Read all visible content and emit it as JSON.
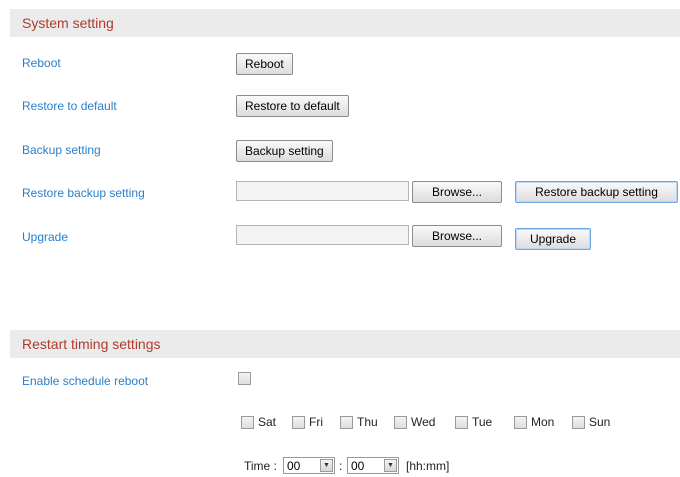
{
  "system_section": {
    "title": "System setting",
    "reboot_label": "Reboot",
    "reboot_button": "Reboot",
    "restore_default_label": "Restore to default",
    "restore_default_button": "Restore to default",
    "backup_label": "Backup setting",
    "backup_button": "Backup setting",
    "restore_backup_label": "Restore backup setting",
    "restore_backup_browse": "Browse...",
    "restore_backup_button": "Restore backup setting",
    "upgrade_label": "Upgrade",
    "upgrade_browse": "Browse...",
    "upgrade_button": "Upgrade"
  },
  "restart_section": {
    "title": "Restart timing settings",
    "enable_label": "Enable schedule reboot",
    "days": [
      "Sat",
      "Fri",
      "Thu",
      "Wed",
      "Tue",
      "Mon",
      "Sun"
    ],
    "time_label": "Time :",
    "hour_value": "00",
    "separator": ":",
    "minute_value": "00",
    "format_hint": "[hh:mm]"
  }
}
